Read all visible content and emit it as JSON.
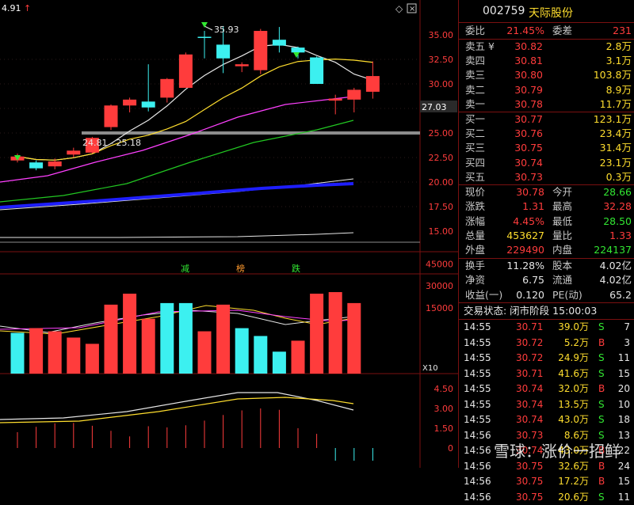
{
  "header": {
    "left_price": "4.91",
    "right_label": "27.03"
  },
  "colors": {
    "up": "#ff3c3c",
    "down": "#32e632",
    "hollow_up": "#ff3c3c",
    "cyan": "#3cf0f0",
    "yellow": "#ffde2e",
    "magenta": "#ff40ff",
    "blue": "#1e1eff",
    "white": "#e6e6e6",
    "green_ma": "#22c822"
  },
  "price_axis": [
    "35.00",
    "32.50",
    "30.00",
    "27.50",
    "25.00",
    "22.50",
    "20.00",
    "17.50",
    "15.00"
  ],
  "price_annotations": {
    "high": "35.93",
    "range": "24.81 - 25.18"
  },
  "signals": [
    "减",
    "榜",
    "跌"
  ],
  "volume_axis": [
    "45000",
    "30000",
    "15000",
    "X10"
  ],
  "macd_axis": [
    "4.50",
    "3.00",
    "1.50",
    "0"
  ],
  "candles": [
    {
      "o": 22.2,
      "c": 22.6,
      "h": 22.9,
      "l": 22.0,
      "dir": "up"
    },
    {
      "o": 21.4,
      "c": 22.0,
      "h": 22.2,
      "l": 21.2,
      "dir": "down"
    },
    {
      "o": 21.6,
      "c": 22.1,
      "h": 22.4,
      "l": 21.3,
      "dir": "up"
    },
    {
      "o": 22.8,
      "c": 23.2,
      "h": 23.5,
      "l": 22.5,
      "dir": "up"
    },
    {
      "o": 23.0,
      "c": 24.5,
      "h": 24.6,
      "l": 22.9,
      "dir": "up"
    },
    {
      "o": 25.6,
      "c": 27.8,
      "h": 27.9,
      "l": 25.3,
      "dir": "up"
    },
    {
      "o": 27.8,
      "c": 28.4,
      "h": 28.6,
      "l": 27.1,
      "dir": "up"
    },
    {
      "o": 28.2,
      "c": 27.6,
      "h": 32.0,
      "l": 27.2,
      "dir": "down"
    },
    {
      "o": 28.6,
      "c": 30.5,
      "h": 30.6,
      "l": 28.1,
      "dir": "up"
    },
    {
      "o": 29.6,
      "c": 33.0,
      "h": 33.2,
      "l": 29.6,
      "dir": "up"
    },
    {
      "o": 34.8,
      "c": 34.8,
      "h": 35.4,
      "l": 32.6,
      "dir": "down"
    },
    {
      "o": 32.6,
      "c": 34.0,
      "h": 35.9,
      "l": 31.1,
      "dir": "down"
    },
    {
      "o": 31.8,
      "c": 32.0,
      "h": 32.2,
      "l": 31.2,
      "dir": "up"
    },
    {
      "o": 31.4,
      "c": 35.4,
      "h": 35.6,
      "l": 31.0,
      "dir": "up"
    },
    {
      "o": 34.5,
      "c": 33.9,
      "h": 35.8,
      "l": 33.2,
      "dir": "down"
    },
    {
      "o": 33.7,
      "c": 33.2,
      "h": 33.8,
      "l": 32.6,
      "dir": "down"
    },
    {
      "o": 32.7,
      "c": 30.0,
      "h": 32.8,
      "l": 30.0,
      "dir": "down"
    },
    {
      "o": 28.3,
      "c": 28.5,
      "h": 28.9,
      "l": 26.9,
      "dir": "up"
    },
    {
      "o": 28.4,
      "c": 29.4,
      "h": 29.6,
      "l": 27.1,
      "dir": "up"
    },
    {
      "o": 29.2,
      "c": 30.8,
      "h": 32.3,
      "l": 28.5,
      "dir": "up"
    }
  ],
  "volumes": [
    {
      "v": 26000,
      "dir": "down"
    },
    {
      "v": 29000,
      "dir": "up"
    },
    {
      "v": 27000,
      "dir": "up"
    },
    {
      "v": 23000,
      "dir": "up"
    },
    {
      "v": 19000,
      "dir": "up"
    },
    {
      "v": 44000,
      "dir": "up"
    },
    {
      "v": 51000,
      "dir": "up"
    },
    {
      "v": 35000,
      "dir": "up"
    },
    {
      "v": 45000,
      "dir": "down"
    },
    {
      "v": 45000,
      "dir": "down"
    },
    {
      "v": 27000,
      "dir": "up"
    },
    {
      "v": 44000,
      "dir": "up"
    },
    {
      "v": 29000,
      "dir": "down"
    },
    {
      "v": 24000,
      "dir": "down"
    },
    {
      "v": 14000,
      "dir": "down"
    },
    {
      "v": 21000,
      "dir": "up"
    },
    {
      "v": 51000,
      "dir": "up"
    },
    {
      "v": 52000,
      "dir": "up"
    },
    {
      "v": 45000,
      "dir": "up"
    }
  ],
  "stock": {
    "code": "002759",
    "name": "天际股份",
    "ratio_label": "委比",
    "ratio": "21.45%",
    "diff_label": "委差",
    "diff": "231",
    "asks": [
      {
        "label": "卖五 ¥",
        "price": "30.82",
        "vol": "2.8万"
      },
      {
        "label": "卖四",
        "price": "30.81",
        "vol": "3.1万"
      },
      {
        "label": "卖三",
        "price": "30.80",
        "vol": "103.8万"
      },
      {
        "label": "卖二",
        "price": "30.79",
        "vol": "8.9万"
      },
      {
        "label": "卖一",
        "price": "30.78",
        "vol": "11.7万"
      }
    ],
    "bids": [
      {
        "label": "买一",
        "price": "30.77",
        "vol": "123.1万"
      },
      {
        "label": "买二",
        "price": "30.76",
        "vol": "23.4万"
      },
      {
        "label": "买三",
        "price": "30.75",
        "vol": "31.4万"
      },
      {
        "label": "买四",
        "price": "30.74",
        "vol": "23.1万"
      },
      {
        "label": "买五",
        "price": "30.73",
        "vol": "0.3万"
      }
    ],
    "quote": [
      {
        "l1": "现价",
        "v1": "30.78",
        "c1": "up",
        "l2": "今开",
        "v2": "28.66",
        "c2": "dn"
      },
      {
        "l1": "涨跌",
        "v1": "1.31",
        "c1": "up",
        "l2": "最高",
        "v2": "32.28",
        "c2": "up"
      },
      {
        "l1": "涨幅",
        "v1": "4.45%",
        "c1": "up",
        "l2": "最低",
        "v2": "28.50",
        "c2": "dn"
      },
      {
        "l1": "总量",
        "v1": "453627",
        "c1": "yl",
        "l2": "量比",
        "v2": "1.33",
        "c2": "up"
      },
      {
        "l1": "外盘",
        "v1": "229490",
        "c1": "up",
        "l2": "内盘",
        "v2": "224137",
        "c2": "dn"
      }
    ],
    "fund": [
      {
        "l1": "换手",
        "v1": "11.28%",
        "l2": "股本",
        "v2": "4.02亿"
      },
      {
        "l1": "净资",
        "v1": "6.75",
        "l2": "流通",
        "v2": "4.02亿"
      },
      {
        "l1": "收益(一)",
        "v1": "0.120",
        "l2": "PE(动)",
        "v2": "65.2"
      }
    ],
    "status": "交易状态: 闭市阶段 15:00:03",
    "ticks": [
      {
        "t": "14:55",
        "p": "30.71",
        "v": "39.0万",
        "s": "S",
        "n": "7"
      },
      {
        "t": "14:55",
        "p": "30.72",
        "v": "5.2万",
        "s": "B",
        "n": "3"
      },
      {
        "t": "14:55",
        "p": "30.72",
        "v": "24.9万",
        "s": "S",
        "n": "11"
      },
      {
        "t": "14:55",
        "p": "30.71",
        "v": "41.6万",
        "s": "S",
        "n": "15"
      },
      {
        "t": "14:55",
        "p": "30.74",
        "v": "32.0万",
        "s": "B",
        "n": "20"
      },
      {
        "t": "14:55",
        "p": "30.74",
        "v": "13.5万",
        "s": "S",
        "n": "10"
      },
      {
        "t": "14:55",
        "p": "30.74",
        "v": "43.0万",
        "s": "S",
        "n": "18"
      },
      {
        "t": "14:56",
        "p": "30.73",
        "v": "8.6万",
        "s": "S",
        "n": "13"
      },
      {
        "t": "14:56",
        "p": "30.74",
        "v": "43.0万",
        "s": "B",
        "n": "22"
      },
      {
        "t": "14:56",
        "p": "30.75",
        "v": "32.6万",
        "s": "B",
        "n": "24"
      },
      {
        "t": "14:56",
        "p": "30.75",
        "v": "17.2万",
        "s": "B",
        "n": "15"
      },
      {
        "t": "14:56",
        "p": "30.75",
        "v": "20.6万",
        "s": "S",
        "n": "11"
      }
    ]
  },
  "watermark": "雪球：涨价一招鲜"
}
